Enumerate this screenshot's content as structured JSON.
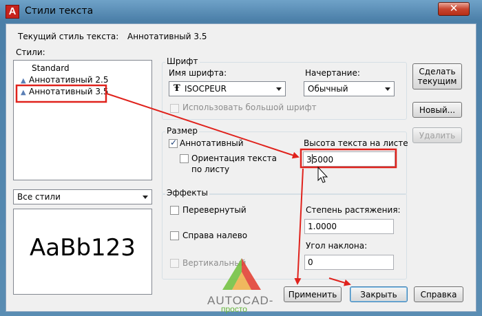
{
  "window": {
    "title": "Стили текста",
    "app_icon": "A",
    "close_glyph": "✕"
  },
  "current_style": {
    "label": "Текущий стиль текста:",
    "value": "Аннотативный 3.5"
  },
  "styles": {
    "label": "Стили:",
    "items": [
      {
        "name": "Standard",
        "annotative": false
      },
      {
        "name": "Аннотативный 2.5",
        "annotative": true
      },
      {
        "name": "Аннотативный 3.5",
        "annotative": true,
        "selected": true
      }
    ],
    "filter": "Все стили",
    "preview": "AaBb123"
  },
  "font": {
    "legend": "Шрифт",
    "name_label": "Имя шрифта:",
    "name_value": "ISOCPEUR",
    "name_icon": "truetype-icon",
    "style_label": "Начертание:",
    "style_value": "Обычный",
    "bigfont_label": "Использовать большой шрифт"
  },
  "size": {
    "legend": "Размер",
    "annotative_label": "Аннотативный",
    "annotative_checked": true,
    "orientation_label_1": "Ориентация текста",
    "orientation_label_2": "по листу",
    "height_label": "Высота текста на листе",
    "height_value": "3.5000",
    "height_value_before_caret": "3",
    "height_value_after_caret": "5000"
  },
  "effects": {
    "legend": "Эффекты",
    "upside_down_label": "Перевернутый",
    "backwards_label": "Справа налево",
    "vertical_label": "Вертикальный",
    "width_label": "Степень растяжения:",
    "width_value": "1.0000",
    "oblique_label": "Угол наклона:",
    "oblique_value": "0"
  },
  "buttons": {
    "set_current": "Сделать текущим",
    "new": "Новый...",
    "delete": "Удалить",
    "apply": "Применить",
    "close": "Закрыть",
    "help": "Справка"
  },
  "watermark": {
    "text_1": "AUTOCAD-",
    "text_2": "просто"
  },
  "colors": {
    "annotation_red": "#e0221c",
    "focus_blue": "#3c7fb1"
  }
}
